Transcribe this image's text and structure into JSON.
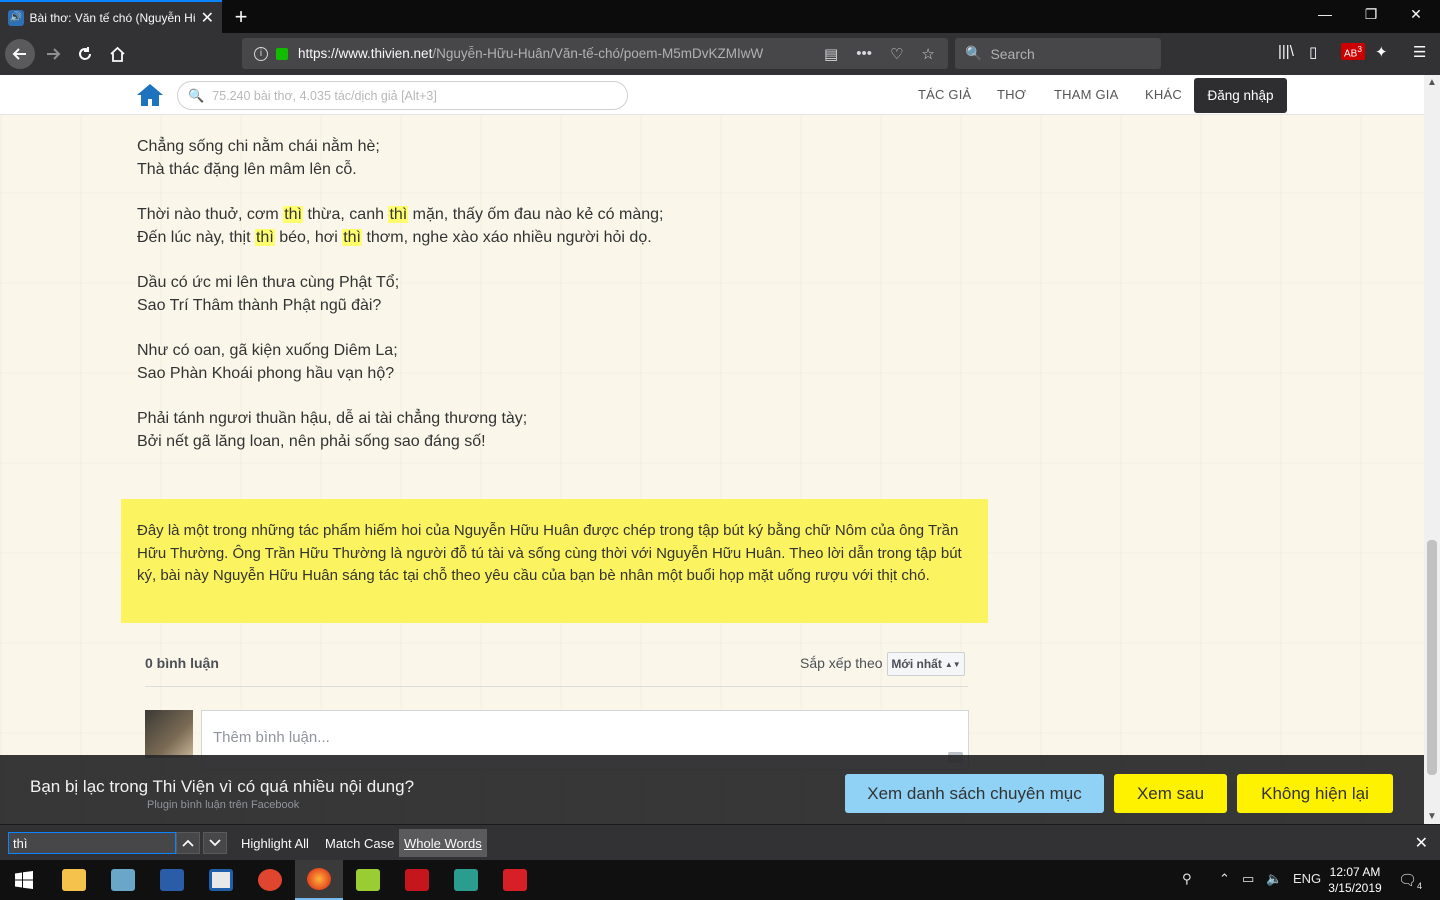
{
  "browser": {
    "tab_title": "Bài thơ: Văn tế chó (Nguyễn Hữ",
    "url_domain": "https://www.thivien.net",
    "url_path": "/Nguyễn-Hữu-Huân/Văn-tế-chó/poem-M5mDvKZMIwW",
    "search_placeholder": "Search",
    "new_tab": "+",
    "adblock_count": "3"
  },
  "site": {
    "search_placeholder": "75.240 bài thơ, 4.035 tác/dịch giả [Alt+3]",
    "menu": [
      "TÁC GIẢ",
      "THƠ",
      "THAM GIA",
      "KHÁC"
    ],
    "login": "Đăng nhập"
  },
  "poem": {
    "stanzas": [
      [
        "Chẳng sống chi nằm chái nằm hè;",
        "Thà thác đặng lên mâm lên cỗ."
      ],
      [
        [
          "Thời nào thuở, cơm ",
          "thì",
          " thừa, canh ",
          "thì",
          " mặn, thấy ốm đau nào kẻ có màng;"
        ],
        [
          "Đến lúc này, thịt ",
          "thì",
          " béo, hơi ",
          "thì",
          " thơm, nghe xào xáo nhiều người hỏi dọ."
        ]
      ],
      [
        "Dầu có ức mi lên thưa cùng Phật Tổ;",
        "Sao Trí Thâm thành Phật ngũ đài?"
      ],
      [
        "Như có oan, gã kiện xuống Diêm La;",
        "Sao Phàn Khoái phong hầu vạn hộ?"
      ],
      [
        "Phải tánh ngươi thuần hậu, dễ ai tài chẳng thương tày;",
        "Bởi nết gã lăng loan, nên phải sống sao đáng số!"
      ]
    ]
  },
  "note": "Đây là một trong những tác phẩm hiếm hoi của Nguyễn Hữu Huân được chép trong tập bút ký bằng chữ Nôm của ông Trần Hữu Thường. Ông Trần Hữu Thường là người đỗ tú tài và sống cùng thời với Nguyễn Hữu Huân. Theo lời dẫn trong tập bút ký, bài này Nguyễn Hữu Huân sáng tác tại chỗ theo yêu cầu của bạn bè nhân một buổi họp mặt uống rượu với thịt chó.",
  "comments": {
    "count_label": "0 bình luận",
    "sort_label": "Sắp xếp theo",
    "sort_value": "Mới nhất",
    "input_placeholder": "Thêm bình luận...",
    "plugin_label": "Plugin bình luận trên Facebook"
  },
  "promo": {
    "text": "Bạn bị lạc trong Thi Viện vì có quá nhiều nội dung?",
    "btn_categories": "Xem danh sách chuyên mục",
    "btn_later": "Xem sau",
    "btn_never": "Không hiện lại"
  },
  "findbar": {
    "query": "thì",
    "highlight_all": "Highlight All",
    "match_case": "Match Case",
    "whole_words": "Whole Words"
  },
  "taskbar": {
    "lang": "ENG",
    "time": "12:07 AM",
    "date": "3/15/2019",
    "notif_count": "4"
  },
  "colors": {
    "accent_blue": "#0a84ff",
    "highlight_yellow": "#ffff6e",
    "note_yellow": "#fbf460",
    "button_yellow": "#fff200",
    "button_blue": "#8fd2f6",
    "site_home_blue": "#1e73be"
  }
}
